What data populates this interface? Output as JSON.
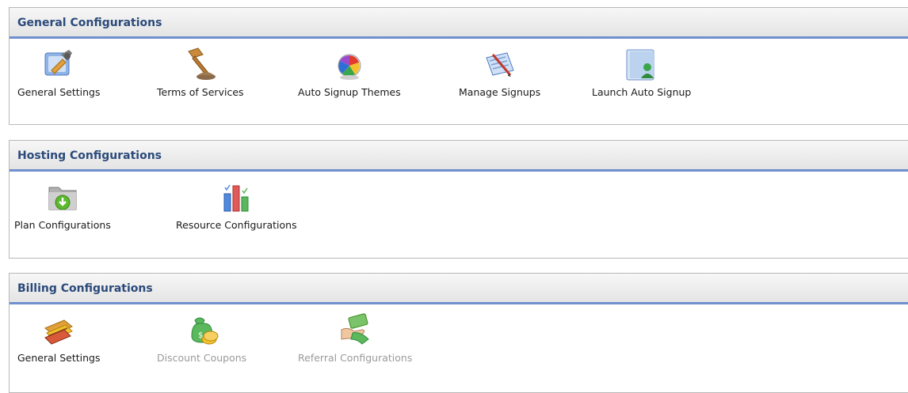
{
  "sections": [
    {
      "title": "General Configurations",
      "items": [
        {
          "label": "General Settings",
          "icon": "settings-wrench-icon",
          "enabled": true
        },
        {
          "label": "Terms of Services",
          "icon": "gavel-icon",
          "enabled": true
        },
        {
          "label": "Auto Signup Themes",
          "icon": "color-palette-icon",
          "enabled": true
        },
        {
          "label": "Manage Signups",
          "icon": "signup-form-icon",
          "enabled": true
        },
        {
          "label": "Launch Auto Signup",
          "icon": "folder-user-icon",
          "enabled": true
        }
      ]
    },
    {
      "title": "Hosting Configurations",
      "items": [
        {
          "label": "Plan Configurations",
          "icon": "folder-download-icon",
          "enabled": true
        },
        {
          "label": "Resource Configurations",
          "icon": "bar-chart-check-icon",
          "enabled": true
        }
      ]
    },
    {
      "title": "Billing Configurations",
      "items": [
        {
          "label": "General Settings",
          "icon": "credit-cards-icon",
          "enabled": true
        },
        {
          "label": "Discount Coupons",
          "icon": "money-bag-coins-icon",
          "enabled": false
        },
        {
          "label": "Referral Configurations",
          "icon": "hand-money-icon",
          "enabled": false
        }
      ]
    }
  ],
  "colors": {
    "header_text": "#2b4a7a",
    "header_rule": "#6f8fcf",
    "disabled_text": "#9a9a9a"
  }
}
